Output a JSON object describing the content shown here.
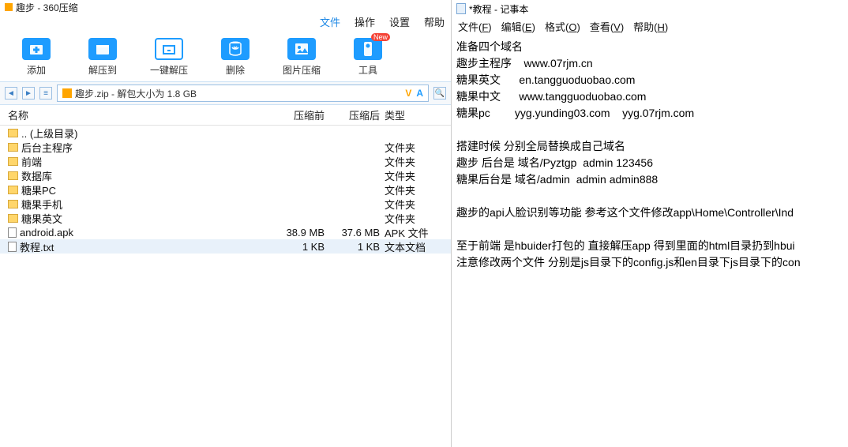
{
  "left": {
    "title": "趣步 - 360压缩",
    "menu": {
      "file": "文件",
      "ops": "操作",
      "settings": "设置",
      "help": "帮助"
    },
    "tools": {
      "add": "添加",
      "extract": "解压到",
      "onekey": "一键解压",
      "delete": "删除",
      "image": "图片压缩",
      "tool": "工具",
      "new_badge": "New"
    },
    "path": "趣步.zip - 解包大小为 1.8 GB",
    "headers": {
      "name": "名称",
      "before": "压缩前",
      "after": "压缩后",
      "type": "类型"
    },
    "rows": [
      {
        "name": ".. (上级目录)",
        "before": "",
        "after": "",
        "type": "",
        "icon": "folder"
      },
      {
        "name": "后台主程序",
        "before": "",
        "after": "",
        "type": "文件夹",
        "icon": "folder"
      },
      {
        "name": "前端",
        "before": "",
        "after": "",
        "type": "文件夹",
        "icon": "folder"
      },
      {
        "name": "数据库",
        "before": "",
        "after": "",
        "type": "文件夹",
        "icon": "folder"
      },
      {
        "name": "糖果PC",
        "before": "",
        "after": "",
        "type": "文件夹",
        "icon": "folder"
      },
      {
        "name": "糖果手机",
        "before": "",
        "after": "",
        "type": "文件夹",
        "icon": "folder"
      },
      {
        "name": "糖果英文",
        "before": "",
        "after": "",
        "type": "文件夹",
        "icon": "folder"
      },
      {
        "name": "android.apk",
        "before": "38.9 MB",
        "after": "37.6 MB",
        "type": "APK 文件",
        "icon": "file"
      },
      {
        "name": "教程.txt",
        "before": "1 KB",
        "after": "1 KB",
        "type": "文本文档",
        "icon": "file",
        "selected": true
      }
    ]
  },
  "right": {
    "title": "*教程 - 记事本",
    "menu": {
      "file": "文件(F)",
      "edit": "编辑(E)",
      "format": "格式(O)",
      "view": "查看(V)",
      "help": "帮助(H)"
    },
    "body": "准备四个域名\n趣步主程序    www.07rjm.cn\n糖果英文      en.tangguoduobao.com\n糖果中文      www.tangguoduobao.com\n糖果pc        yyg.yunding03.com    yyg.07rjm.com\n\n搭建时候 分别全局替换成自己域名\n趣步 后台是 域名/Pyztgp  admin 123456\n糖果后台是 域名/admin  admin admin888\n\n趣步的api人脸识别等功能 参考这个文件修改app\\Home\\Controller\\Ind\n\n至于前端 是hbuider打包的 直接解压app 得到里面的html目录扔到hbui\n注意修改两个文件 分别是js目录下的config.js和en目录下js目录下的con"
  }
}
